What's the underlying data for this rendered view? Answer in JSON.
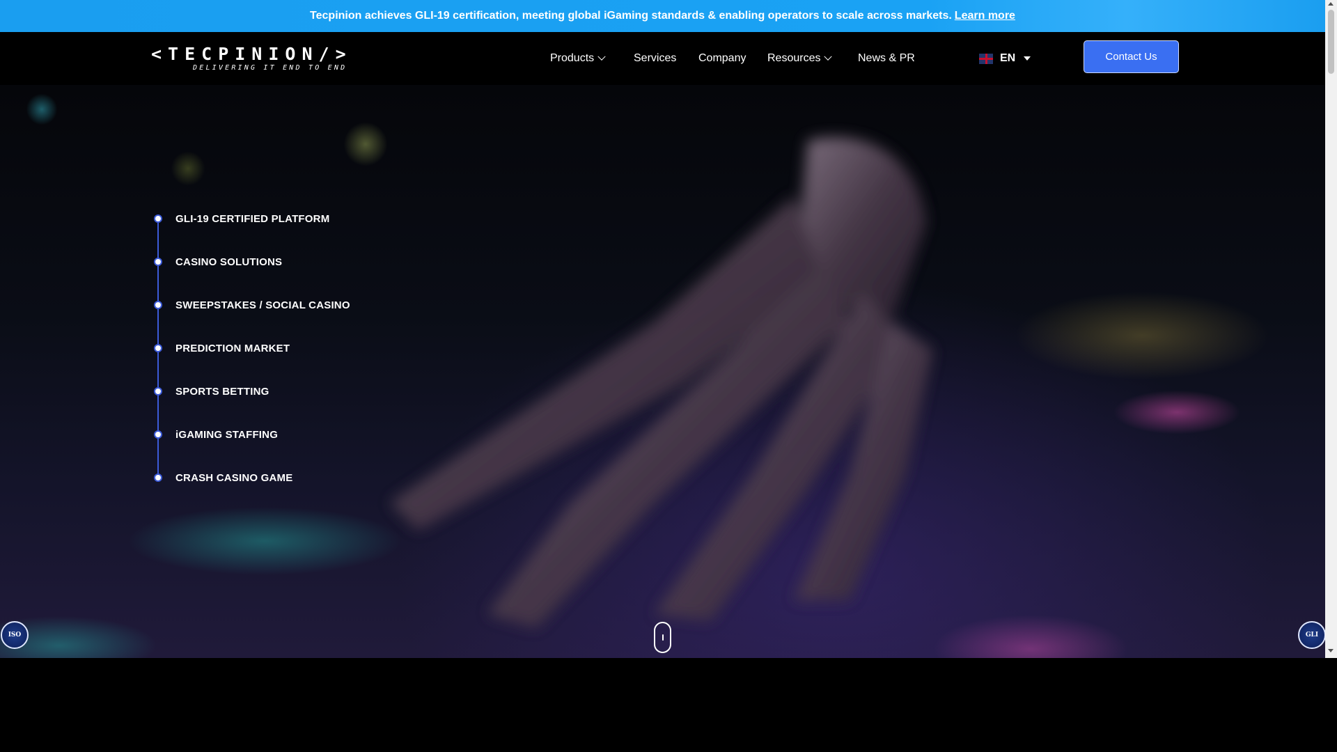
{
  "announcement": {
    "message": "Tecpinion achieves GLI-19 certification, meeting global iGaming standards & enabling operators to scale across markets.",
    "link_label": "Learn more"
  },
  "header": {
    "logo": {
      "wordmark": "<TECPINION/>",
      "tagline": "DELIVERING IT END TO END"
    },
    "nav": [
      {
        "label": "Products",
        "has_dropdown": true
      },
      {
        "label": "Services",
        "has_dropdown": false
      },
      {
        "label": "Company",
        "has_dropdown": false
      },
      {
        "label": "Resources",
        "has_dropdown": true
      },
      {
        "label": "News & PR",
        "has_dropdown": false
      }
    ],
    "language": {
      "code": "EN",
      "flag": "uk-flag-icon"
    },
    "contact_label": "Contact Us"
  },
  "hero": {
    "timeline": [
      "GLI-19 CERTIFIED PLATFORM",
      "CASINO SOLUTIONS",
      "SWEEPSTAKES / SOCIAL CASINO",
      "PREDICTION MARKET",
      "SPORTS BETTING",
      "iGAMING STAFFING",
      "CRASH CASINO GAME"
    ],
    "badges": {
      "iso": "ISO",
      "gli": "GLI"
    }
  },
  "colors": {
    "announcement_bg": "#1a9ef0",
    "contact_button": "#3a6ff2",
    "timeline_accent": "#3c5bd9",
    "page_bg": "#000000"
  }
}
